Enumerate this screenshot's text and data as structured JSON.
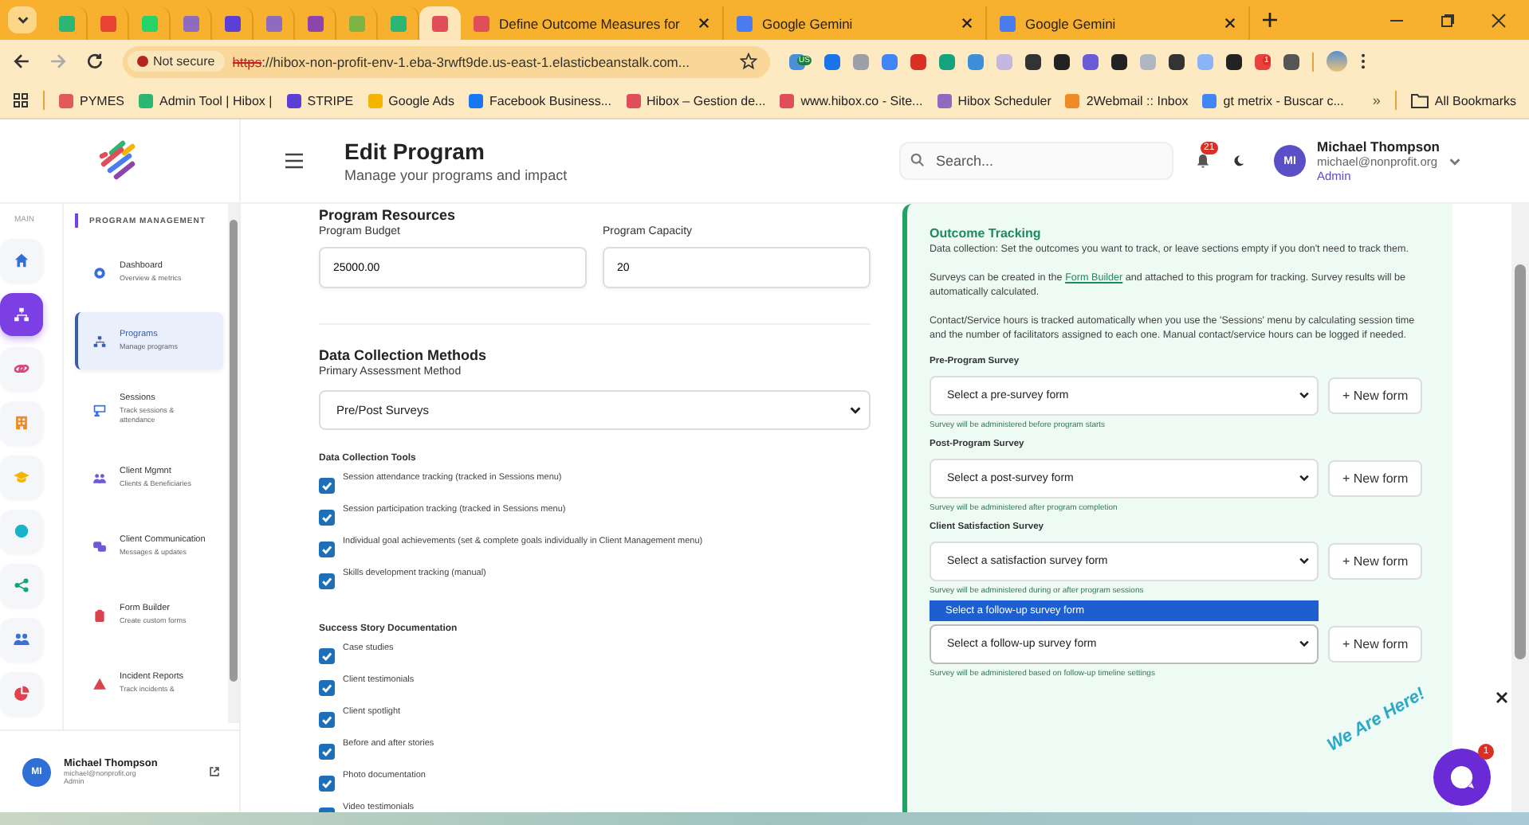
{
  "browser": {
    "tabs": [
      {
        "kind": "pinned",
        "color": "#2bb673",
        "selected": false
      },
      {
        "kind": "pinned",
        "color": "#ea4335",
        "selected": false
      },
      {
        "kind": "pinned",
        "color": "#25d366",
        "selected": false
      },
      {
        "kind": "pinned",
        "color": "#8e6bbf",
        "selected": false
      },
      {
        "kind": "pinned",
        "color": "#5b3fd6",
        "selected": false
      },
      {
        "kind": "pinned",
        "color": "#8e6bbf",
        "selected": false
      },
      {
        "kind": "pinned",
        "color": "#8e44ad",
        "selected": false
      },
      {
        "kind": "pinned",
        "color": "#7cb342",
        "selected": false
      },
      {
        "kind": "pinned",
        "color": "#2bb673",
        "selected": false
      },
      {
        "kind": "pinned",
        "color": "#e04e5a",
        "selected": true
      },
      {
        "kind": "titled",
        "color": "#e04e5a",
        "title": "Define Outcome Measures for",
        "selected": false
      },
      {
        "kind": "titled",
        "color": "#4a7cf0",
        "title": "Google Gemini",
        "selected": false
      },
      {
        "kind": "titled",
        "color": "#4a7cf0",
        "title": "Google Gemini",
        "selected": false
      }
    ],
    "security": "Not secure",
    "url_scheme": "https",
    "url_rest": "://hibox-non-profit-env-1.eba-3rwft9de.us-east-1.elasticbeanstalk.com...",
    "extensions": [
      {
        "color": "#4a90d9",
        "badge": "US"
      },
      {
        "color": "#1a73e8"
      },
      {
        "color": "#9aa0a6"
      },
      {
        "color": "#4285f4"
      },
      {
        "color": "#d93025"
      },
      {
        "color": "#15a37f"
      },
      {
        "color": "#3d8ed9"
      },
      {
        "color": "#c5b7e0"
      },
      {
        "color": "#333333"
      },
      {
        "color": "#222222"
      },
      {
        "color": "#6b5bd6"
      },
      {
        "color": "#222222"
      },
      {
        "color": "#b0b7c3"
      },
      {
        "color": "#333333"
      },
      {
        "color": "#8ab4f8"
      },
      {
        "color": "#222222"
      },
      {
        "color": "#e94040",
        "badge": "1"
      },
      {
        "color": "#555555"
      }
    ],
    "bookmarks": [
      {
        "label": "PYMES",
        "color": "#e05a5a"
      },
      {
        "label": "Admin Tool | Hibox |",
        "color": "#2bb673"
      },
      {
        "label": "STRIPE",
        "color": "#5b3fd6"
      },
      {
        "label": "Google Ads",
        "color": "#f4b400"
      },
      {
        "label": "Facebook Business...",
        "color": "#1877f2"
      },
      {
        "label": "Hibox – Gestion de...",
        "color": "#e04e5a"
      },
      {
        "label": "www.hibox.co - Site...",
        "color": "#e04e5a"
      },
      {
        "label": "Hibox Scheduler",
        "color": "#8e6bbf"
      },
      {
        "label": "2Webmail :: Inbox",
        "color": "#f08a24"
      },
      {
        "label": "gt metrix - Buscar c...",
        "color": "#4285f4"
      }
    ],
    "more_bookmarks": "»",
    "all_bookmarks": "All Bookmarks"
  },
  "header": {
    "title": "Edit Program",
    "subtitle": "Manage your programs and impact",
    "search_placeholder": "Search...",
    "notification_count": "21",
    "user": {
      "initials": "MI",
      "name": "Michael Thompson",
      "email": "michael@nonprofit.org",
      "role": "Admin"
    }
  },
  "sidebar": {
    "rail_label": "MAIN",
    "rail": [
      {
        "color": "#2f6fd6",
        "selected": false
      },
      {
        "color": "#ffffff",
        "selected": true
      },
      {
        "color": "#d9437a",
        "selected": false
      },
      {
        "color": "#f08a24",
        "selected": false
      },
      {
        "color": "#f4b400",
        "selected": false
      },
      {
        "color": "#17b3c9",
        "selected": false
      },
      {
        "color": "#15a37f",
        "selected": false
      },
      {
        "color": "#3b6fd8",
        "selected": false
      },
      {
        "color": "#e0434f",
        "selected": false
      }
    ],
    "section": "PROGRAM MANAGEMENT",
    "items": [
      {
        "title": "Dashboard",
        "subtitle": "Overview & metrics",
        "color": "#3b6fd8",
        "selected": false
      },
      {
        "title": "Programs",
        "subtitle": "Manage programs",
        "color": "#3b5bab",
        "selected": true
      },
      {
        "title": "Sessions",
        "subtitle": "Track sessions & attendance",
        "color": "#3b6fd8",
        "selected": false
      },
      {
        "title": "Client Mgmnt",
        "subtitle": "Clients & Beneficiaries",
        "color": "#6b5bd6",
        "selected": false
      },
      {
        "title": "Client Communication",
        "subtitle": "Messages & updates",
        "color": "#6b5bd6",
        "selected": false
      },
      {
        "title": "Form Builder",
        "subtitle": "Create custom forms",
        "color": "#d9434f",
        "selected": false
      },
      {
        "title": "Incident Reports",
        "subtitle": "Track incidents &",
        "color": "#d9434f",
        "selected": false
      }
    ],
    "user": {
      "initials": "MI",
      "name": "Michael Thompson",
      "email": "michael@nonprofit.org",
      "role": "Admin"
    }
  },
  "resources": {
    "heading": "Program Resources",
    "fields": [
      {
        "label": "Program Budget",
        "value": "25000.00"
      },
      {
        "label": "Program Capacity",
        "value": "20"
      }
    ]
  },
  "data_collection": {
    "heading": "Data Collection Methods",
    "method_label": "Primary Assessment Method",
    "method_value": "Pre/Post Surveys",
    "groups": [
      {
        "heading": "Data Collection Tools",
        "items": [
          {
            "label": "Session attendance tracking (tracked in Sessions menu)",
            "checked": true
          },
          {
            "label": "Session participation tracking (tracked in Sessions menu)",
            "checked": true
          },
          {
            "label": "Individual goal achievements (set & complete goals individually in Client Management menu)",
            "checked": true
          },
          {
            "label": "Skills development tracking (manual)",
            "checked": true
          }
        ]
      },
      {
        "heading": "Success Story Documentation",
        "items": [
          {
            "label": "Case studies",
            "checked": true
          },
          {
            "label": "Client testimonials",
            "checked": true
          },
          {
            "label": "Client spotlight",
            "checked": true
          },
          {
            "label": "Before and after stories",
            "checked": true
          },
          {
            "label": "Photo documentation",
            "checked": true
          },
          {
            "label": "Video testimonials",
            "checked": true
          }
        ]
      }
    ]
  },
  "outcome_tracking": {
    "heading": "Outcome Tracking",
    "intro": "Data collection: Set the outcomes you want to track, or leave sections empty if you don't need to track them.",
    "surveys_text": {
      "before": "Surveys can be created in the ",
      "link": "Form Builder",
      "after": " and attached to this program for tracking. Survey results will be automatically calculated."
    },
    "hours_text": "Contact/Service hours is tracked automatically when you use the 'Sessions' menu by calculating session time and the number of facilitators assigned to each one. Manual contact/service hours can be logged if needed.",
    "surveys": [
      {
        "label": "Pre-Program Survey",
        "value": "Select a pre-survey form",
        "button": "+ New form",
        "hint": "Survey will be administered before program starts",
        "expanded": false
      },
      {
        "label": "Post-Program Survey",
        "value": "Select a post-survey form",
        "button": "+ New form",
        "hint": "Survey will be administered after program completion",
        "expanded": false
      },
      {
        "label": "Client Satisfaction Survey",
        "value": "Select a satisfaction survey form",
        "button": "+ New form",
        "hint": "Survey will be administered during or after program sessions",
        "expanded": false
      },
      {
        "value": "Select a follow-up survey form",
        "button": "+ New form",
        "hint": "Survey will be administered based on follow-up timeline settings",
        "expanded": true,
        "options": [
          {
            "label": "Select a follow-up survey form",
            "selected": true
          }
        ]
      }
    ]
  },
  "chat_widget": {
    "text": "We Are Here!",
    "badge": "1"
  }
}
